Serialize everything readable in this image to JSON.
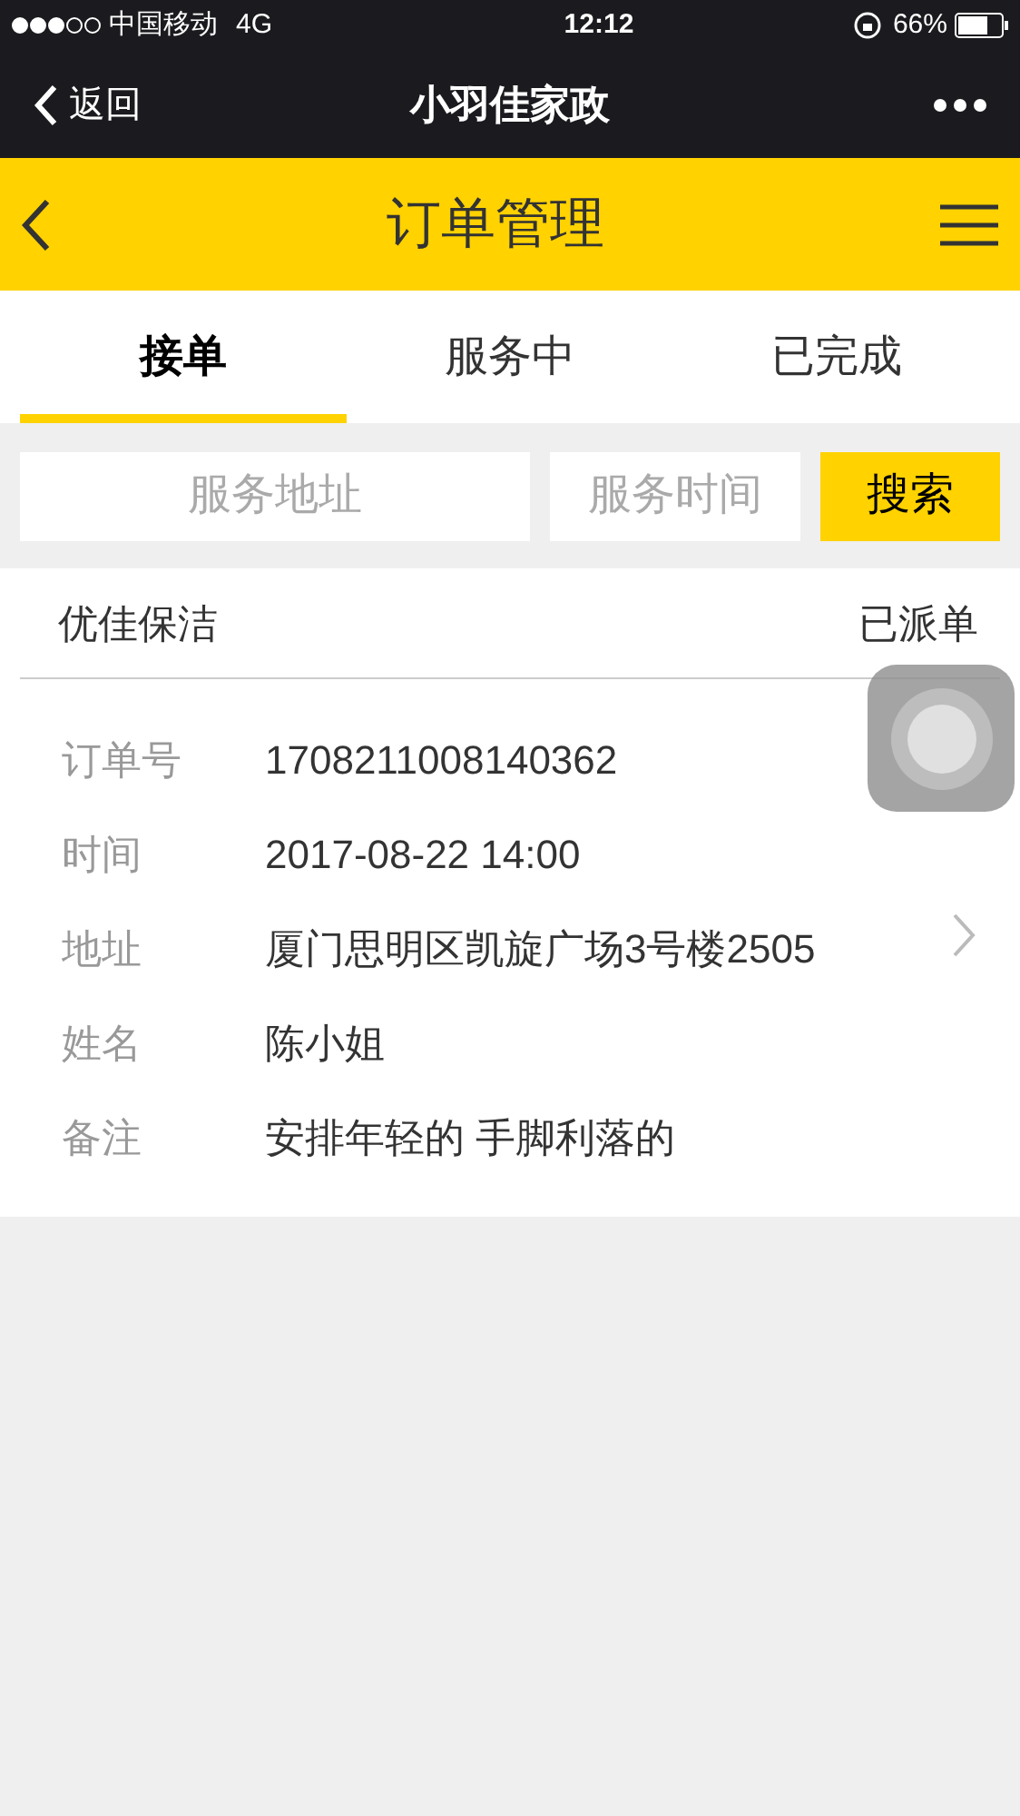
{
  "status_bar": {
    "carrier": "中国移动",
    "network": "4G",
    "time": "12:12",
    "battery": "66%"
  },
  "nav_bar": {
    "back": "返回",
    "title": "小羽佳家政"
  },
  "header": {
    "title": "订单管理"
  },
  "tabs": [
    {
      "label": "接单",
      "selected": true
    },
    {
      "label": "服务中",
      "selected": false
    },
    {
      "label": "已完成",
      "selected": false
    }
  ],
  "search": {
    "address_placeholder": "服务地址",
    "time_placeholder": "服务时间",
    "button": "搜索"
  },
  "order": {
    "service": "优佳保洁",
    "status": "已派单",
    "fields": [
      {
        "label": "订单号",
        "value": "1708211008140362"
      },
      {
        "label": "时间",
        "value": "2017-08-22 14:00"
      },
      {
        "label": "地址",
        "value": "厦门思明区凯旋广场3号楼2505"
      },
      {
        "label": "姓名",
        "value": "陈小姐"
      },
      {
        "label": "备注",
        "value": "安排年轻的 手脚利落的"
      }
    ]
  }
}
